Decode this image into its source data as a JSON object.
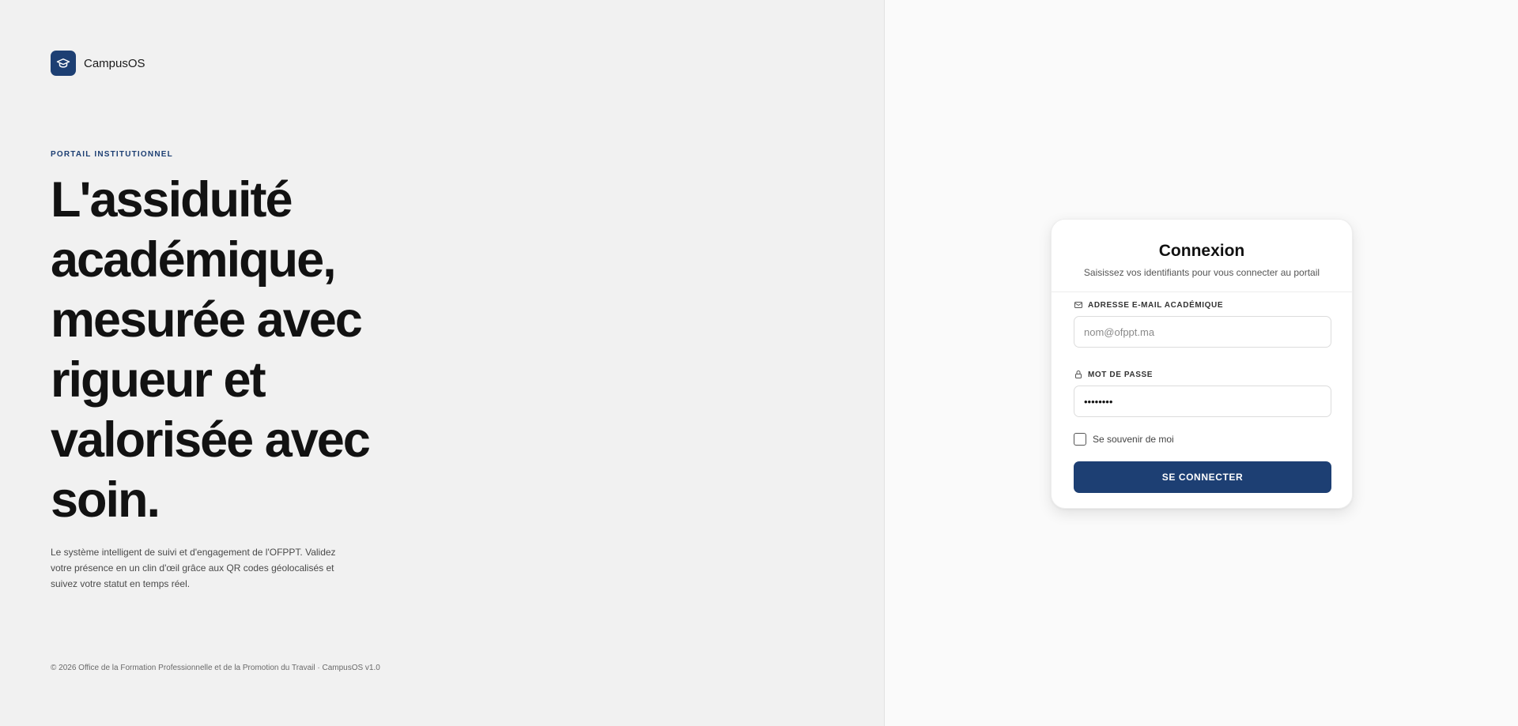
{
  "brand": {
    "name": "CampusOS",
    "logo_icon": "graduation-cap-icon"
  },
  "hero": {
    "eyebrow": "PORTAIL INSTITUTIONNEL",
    "headline": "L'assiduité académique, mesurée avec rigueur et valorisée avec soin.",
    "description": "Le système intelligent de suivi et d'engagement de l'OFPPT. Validez votre présence en un clin d'œil grâce aux QR codes géolocalisés et suivez votre statut en temps réel."
  },
  "footer": {
    "text": "© 2026 Office de la Formation Professionnelle et de la Promotion du Travail · CampusOS v1.0"
  },
  "login": {
    "title": "Connexion",
    "subtitle": "Saisissez vos identifiants pour vous connecter au portail",
    "email": {
      "label": "ADRESSE E-MAIL ACADÉMIQUE",
      "placeholder": "nom@ofppt.ma",
      "value": "",
      "icon": "mail-icon"
    },
    "password": {
      "label": "MOT DE PASSE",
      "value": "••••••••",
      "icon": "lock-icon"
    },
    "remember": {
      "label": "Se souvenir de moi",
      "checked": false
    },
    "submit_label": "SE CONNECTER"
  },
  "colors": {
    "accent": "#1d3f73",
    "left_background": "#f1f1f1",
    "right_background": "#fafafa"
  }
}
